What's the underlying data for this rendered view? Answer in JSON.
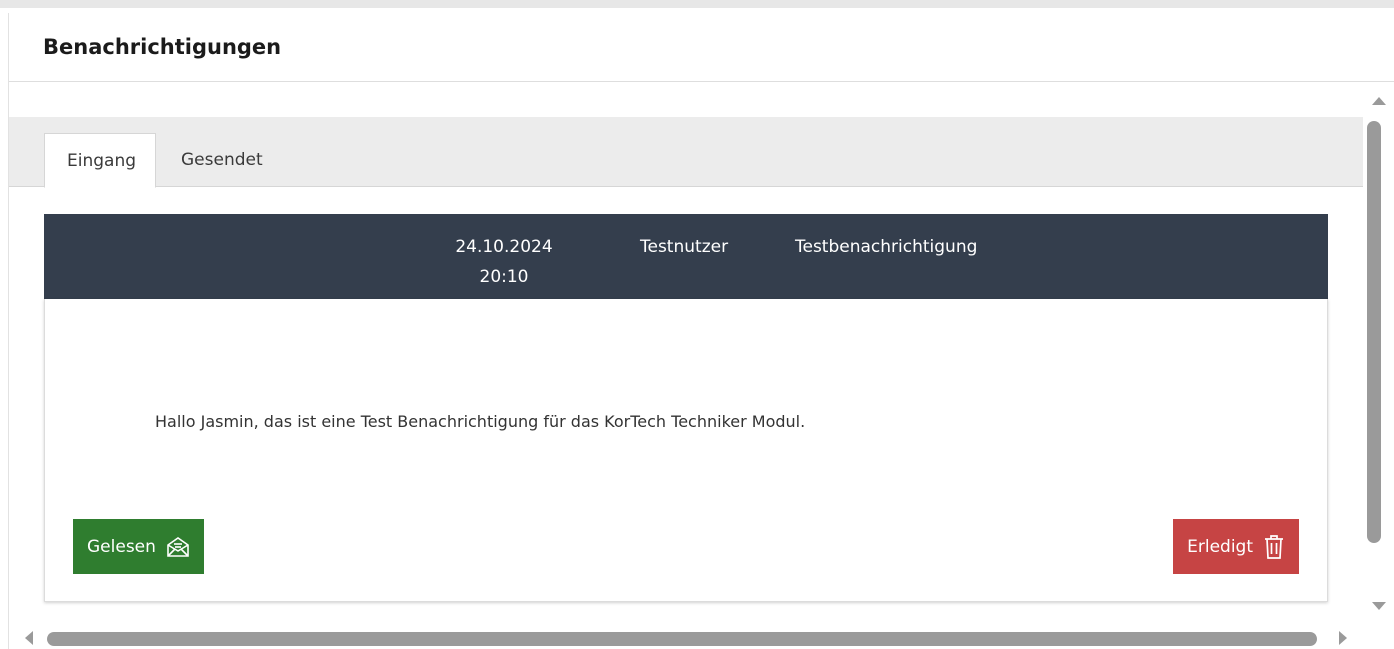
{
  "header": {
    "title": "Benachrichtigungen"
  },
  "tabs": [
    {
      "label": "Eingang",
      "active": true
    },
    {
      "label": "Gesendet",
      "active": false
    }
  ],
  "message": {
    "date": "24.10.2024",
    "time": "20:10",
    "sender": "Testnutzer",
    "subject": "Testbenachrichtigung",
    "body": "Hallo Jasmin, das ist eine Test Benachrichtigung für das KorTech Techniker Modul."
  },
  "actions": {
    "read_label": "Gelesen",
    "read_icon": "envelope-open-icon",
    "done_label": "Erledigt",
    "done_icon": "trash-icon"
  },
  "colors": {
    "header_bg": "#343e4d",
    "read_button": "#2f7d2f",
    "done_button": "#c64444",
    "tabbar_bg": "#ececec"
  }
}
